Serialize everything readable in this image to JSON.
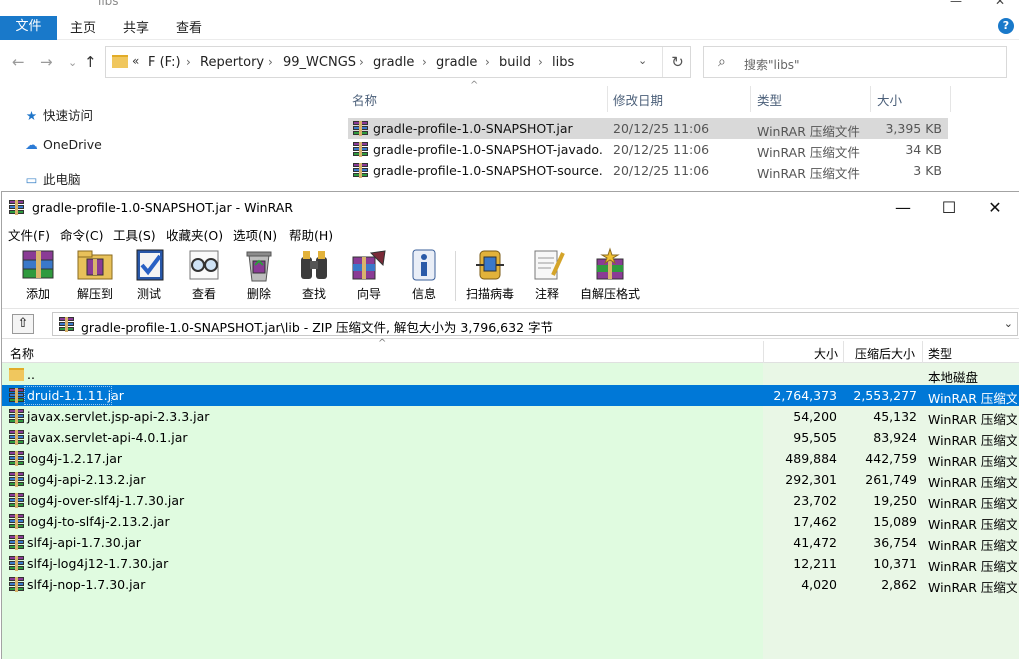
{
  "explorer": {
    "title": "libs",
    "ribbon_tabs": [
      "文件",
      "主页",
      "共享",
      "查看"
    ],
    "address": {
      "prefix": "«",
      "crumbs": [
        "F (F:)",
        "Repertory",
        "99_WCNGS",
        "gradle",
        "gradle",
        "build",
        "libs"
      ]
    },
    "search_placeholder": "搜索\"libs\"",
    "nav_items": [
      "快速访问",
      "OneDrive",
      "此电脑"
    ],
    "columns": [
      "名称",
      "修改日期",
      "类型",
      "大小"
    ],
    "files": [
      {
        "name": "gradle-profile-1.0-SNAPSHOT.jar",
        "date": "20/12/25 11:06",
        "type": "WinRAR 压缩文件",
        "size": "3,395 KB"
      },
      {
        "name": "gradle-profile-1.0-SNAPSHOT-javado...",
        "date": "20/12/25 11:06",
        "type": "WinRAR 压缩文件",
        "size": "34 KB"
      },
      {
        "name": "gradle-profile-1.0-SNAPSHOT-source...",
        "date": "20/12/25 11:06",
        "type": "WinRAR 压缩文件",
        "size": "3 KB"
      }
    ]
  },
  "winrar": {
    "title": "gradle-profile-1.0-SNAPSHOT.jar - WinRAR",
    "menu": [
      "文件(F)",
      "命令(C)",
      "工具(S)",
      "收藏夹(O)",
      "选项(N)",
      "帮助(H)"
    ],
    "toolbar": [
      "添加",
      "解压到",
      "测试",
      "查看",
      "删除",
      "查找",
      "向导",
      "信息",
      "扫描病毒",
      "注释",
      "自解压格式"
    ],
    "path_text": "gradle-profile-1.0-SNAPSHOT.jar\\lib - ZIP 压缩文件, 解包大小为 3,796,632 字节",
    "columns": {
      "name": "名称",
      "size": "大小",
      "packed": "压缩后大小",
      "type": "类型"
    },
    "parent_row": {
      "name": "..",
      "type": "本地磁盘"
    },
    "rows": [
      {
        "name": "druid-1.1.11.jar",
        "size": "2,764,373",
        "packed": "2,553,277",
        "type": "WinRAR 压缩文件"
      },
      {
        "name": "javax.servlet.jsp-api-2.3.3.jar",
        "size": "54,200",
        "packed": "45,132",
        "type": "WinRAR 压缩文件"
      },
      {
        "name": "javax.servlet-api-4.0.1.jar",
        "size": "95,505",
        "packed": "83,924",
        "type": "WinRAR 压缩文件"
      },
      {
        "name": "log4j-1.2.17.jar",
        "size": "489,884",
        "packed": "442,759",
        "type": "WinRAR 压缩文件"
      },
      {
        "name": "log4j-api-2.13.2.jar",
        "size": "292,301",
        "packed": "261,749",
        "type": "WinRAR 压缩文件"
      },
      {
        "name": "log4j-over-slf4j-1.7.30.jar",
        "size": "23,702",
        "packed": "19,250",
        "type": "WinRAR 压缩文件"
      },
      {
        "name": "log4j-to-slf4j-2.13.2.jar",
        "size": "17,462",
        "packed": "15,089",
        "type": "WinRAR 压缩文件"
      },
      {
        "name": "slf4j-api-1.7.30.jar",
        "size": "41,472",
        "packed": "36,754",
        "type": "WinRAR 压缩文件"
      },
      {
        "name": "slf4j-log4j12-1.7.30.jar",
        "size": "12,211",
        "packed": "10,371",
        "type": "WinRAR 压缩文件"
      },
      {
        "name": "slf4j-nop-1.7.30.jar",
        "size": "4,020",
        "packed": "2,862",
        "type": "WinRAR 压缩文件"
      }
    ],
    "selected_row": "druid-1.1.11.jar",
    "colors": {
      "selection": "#0078d7",
      "list_bg": "#e0fbe0",
      "ribbon_file_tab": "#1979ca"
    }
  }
}
